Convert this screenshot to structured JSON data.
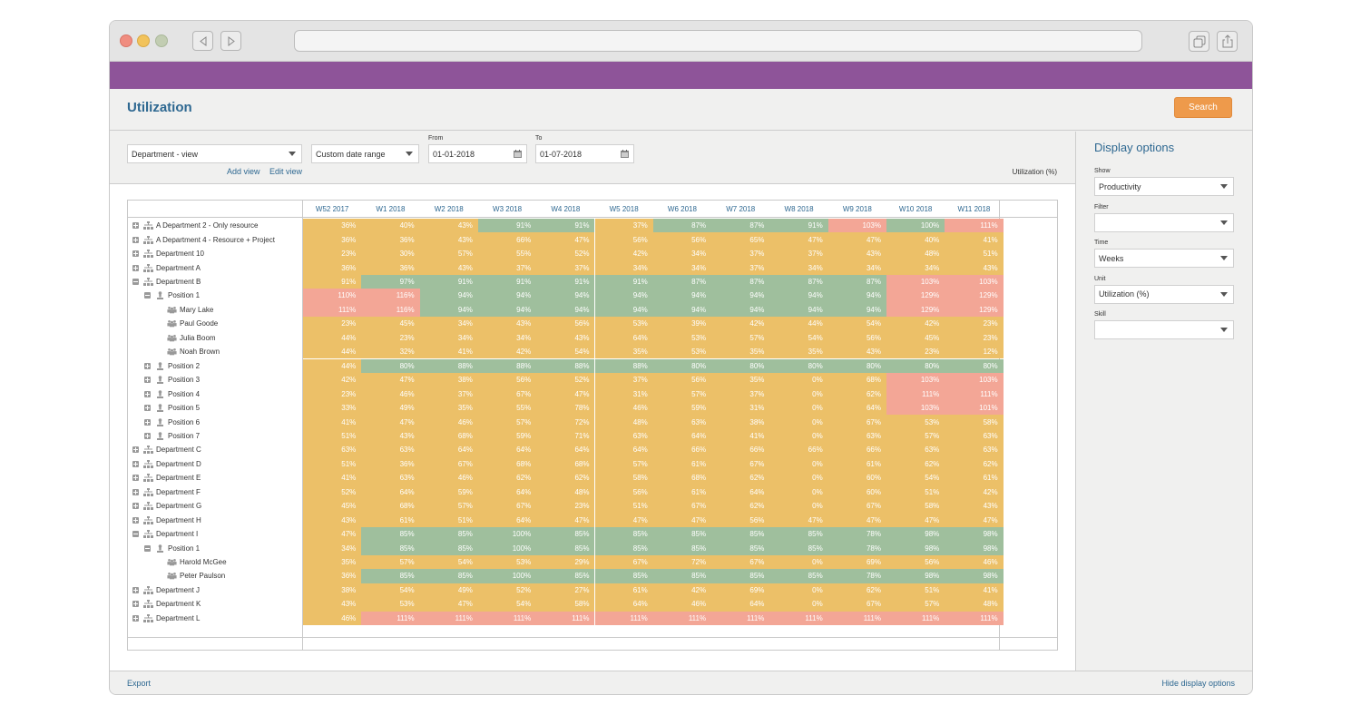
{
  "browser": {
    "traffic_lights": [
      "close",
      "minimize",
      "zoom"
    ],
    "back_icon": "back-arrow-icon",
    "forward_icon": "forward-arrow-icon",
    "url": ""
  },
  "page": {
    "title": "Utilization",
    "search_label": "Search"
  },
  "filters": {
    "view_select": "Department - view",
    "date_range_select": "Custom date range",
    "from_label": "From",
    "from_value": "01-01-2018",
    "to_label": "To",
    "to_value": "01-07-2018",
    "add_view": "Add view",
    "edit_view": "Edit view",
    "unit_label": "Utilization (%)"
  },
  "colors": {
    "purple_bar": "#8e5499",
    "accent_blue": "#2e6891",
    "search_orange": "#ee9a4b",
    "under": "#ecc068",
    "optimal": "#9fbf9d",
    "over": "#f3a696"
  },
  "grid": {
    "columns": [
      "W52 2017",
      "W1 2018",
      "W2 2018",
      "W3 2018",
      "W4 2018",
      "W5 2018",
      "W6 2018",
      "W7 2018",
      "W8 2018",
      "W9 2018",
      "W10 2018",
      "W11 2018"
    ],
    "rows": [
      {
        "name": "A Department 2 - Only resource",
        "level": 0,
        "type": "department",
        "expanded": false,
        "values": [
          "36%",
          "40%",
          "43%",
          "91%",
          "91%",
          "37%",
          "87%",
          "87%",
          "91%",
          "103%",
          "100%",
          "111%"
        ],
        "status": [
          "u",
          "u",
          "u",
          "g",
          "g",
          "u",
          "g",
          "g",
          "g",
          "r",
          "g",
          "r"
        ]
      },
      {
        "name": "A Department 4 - Resource + Project",
        "level": 0,
        "type": "department",
        "expanded": false,
        "values": [
          "36%",
          "36%",
          "43%",
          "66%",
          "47%",
          "56%",
          "56%",
          "65%",
          "47%",
          "47%",
          "40%",
          "41%"
        ],
        "status": [
          "u",
          "u",
          "u",
          "u",
          "u",
          "u",
          "u",
          "u",
          "u",
          "u",
          "u",
          "u"
        ]
      },
      {
        "name": "Department 10",
        "level": 0,
        "type": "department",
        "expanded": false,
        "values": [
          "23%",
          "30%",
          "57%",
          "55%",
          "52%",
          "42%",
          "34%",
          "37%",
          "37%",
          "43%",
          "48%",
          "51%"
        ],
        "status": [
          "u",
          "u",
          "u",
          "u",
          "u",
          "u",
          "u",
          "u",
          "u",
          "u",
          "u",
          "u"
        ]
      },
      {
        "name": "Department A",
        "level": 0,
        "type": "department",
        "expanded": false,
        "values": [
          "36%",
          "36%",
          "43%",
          "37%",
          "37%",
          "34%",
          "34%",
          "37%",
          "34%",
          "34%",
          "34%",
          "43%"
        ],
        "status": [
          "u",
          "u",
          "u",
          "u",
          "u",
          "u",
          "u",
          "u",
          "u",
          "u",
          "u",
          "u"
        ]
      },
      {
        "name": "Department B",
        "level": 0,
        "type": "department",
        "expanded": true,
        "values": [
          "91%",
          "97%",
          "91%",
          "91%",
          "91%",
          "91%",
          "87%",
          "87%",
          "87%",
          "87%",
          "103%",
          "103%"
        ],
        "status": [
          "u",
          "g",
          "g",
          "g",
          "g",
          "g",
          "g",
          "g",
          "g",
          "g",
          "r",
          "r"
        ]
      },
      {
        "name": "Position 1",
        "level": 1,
        "type": "position",
        "expanded": true,
        "values": [
          "110%",
          "116%",
          "94%",
          "94%",
          "94%",
          "94%",
          "94%",
          "94%",
          "94%",
          "94%",
          "129%",
          "129%"
        ],
        "status": [
          "r",
          "r",
          "g",
          "g",
          "g",
          "g",
          "g",
          "g",
          "g",
          "g",
          "r",
          "r"
        ]
      },
      {
        "name": "Mary Lake",
        "level": 2,
        "type": "person",
        "values": [
          "111%",
          "116%",
          "94%",
          "94%",
          "94%",
          "94%",
          "94%",
          "94%",
          "94%",
          "94%",
          "129%",
          "129%"
        ],
        "status": [
          "r",
          "r",
          "g",
          "g",
          "g",
          "g",
          "g",
          "g",
          "g",
          "g",
          "r",
          "r"
        ]
      },
      {
        "name": "Paul Goode",
        "level": 2,
        "type": "person",
        "values": [
          "23%",
          "45%",
          "34%",
          "43%",
          "56%",
          "53%",
          "39%",
          "42%",
          "44%",
          "54%",
          "42%",
          "23%"
        ],
        "status": [
          "u",
          "u",
          "u",
          "u",
          "u",
          "u",
          "u",
          "u",
          "u",
          "u",
          "u",
          "u"
        ]
      },
      {
        "name": "Julia Boom",
        "level": 2,
        "type": "person",
        "values": [
          "44%",
          "23%",
          "34%",
          "34%",
          "43%",
          "64%",
          "53%",
          "57%",
          "54%",
          "56%",
          "45%",
          "23%"
        ],
        "status": [
          "u",
          "u",
          "u",
          "u",
          "u",
          "u",
          "u",
          "u",
          "u",
          "u",
          "u",
          "u"
        ]
      },
      {
        "name": "Noah Brown",
        "level": 2,
        "type": "person",
        "values": [
          "44%",
          "32%",
          "41%",
          "42%",
          "54%",
          "35%",
          "53%",
          "35%",
          "35%",
          "43%",
          "23%",
          "12%"
        ],
        "status": [
          "u",
          "u",
          "u",
          "u",
          "u",
          "u",
          "u",
          "u",
          "u",
          "u",
          "u",
          "u"
        ]
      },
      {
        "name": "Position 2",
        "level": 1,
        "type": "position",
        "expanded": false,
        "values": [
          "44%",
          "80%",
          "88%",
          "88%",
          "88%",
          "88%",
          "80%",
          "80%",
          "80%",
          "80%",
          "80%",
          "80%"
        ],
        "status": [
          "u",
          "g",
          "g",
          "g",
          "g",
          "g",
          "g",
          "g",
          "g",
          "g",
          "g",
          "g"
        ]
      },
      {
        "name": "Position 3",
        "level": 1,
        "type": "position",
        "expanded": false,
        "values": [
          "42%",
          "47%",
          "38%",
          "56%",
          "52%",
          "37%",
          "56%",
          "35%",
          "0%",
          "68%",
          "103%",
          "103%"
        ],
        "status": [
          "u",
          "u",
          "u",
          "u",
          "u",
          "u",
          "u",
          "u",
          "u",
          "u",
          "r",
          "r"
        ]
      },
      {
        "name": "Position 4",
        "level": 1,
        "type": "position",
        "expanded": false,
        "values": [
          "23%",
          "46%",
          "37%",
          "67%",
          "47%",
          "31%",
          "57%",
          "37%",
          "0%",
          "62%",
          "111%",
          "111%"
        ],
        "status": [
          "u",
          "u",
          "u",
          "u",
          "u",
          "u",
          "u",
          "u",
          "u",
          "u",
          "r",
          "r"
        ]
      },
      {
        "name": "Position 5",
        "level": 1,
        "type": "position",
        "expanded": false,
        "values": [
          "33%",
          "49%",
          "35%",
          "55%",
          "78%",
          "46%",
          "59%",
          "31%",
          "0%",
          "64%",
          "103%",
          "101%"
        ],
        "status": [
          "u",
          "u",
          "u",
          "u",
          "u",
          "u",
          "u",
          "u",
          "u",
          "u",
          "r",
          "r"
        ]
      },
      {
        "name": "Position 6",
        "level": 1,
        "type": "position",
        "expanded": false,
        "values": [
          "41%",
          "47%",
          "46%",
          "57%",
          "72%",
          "48%",
          "63%",
          "38%",
          "0%",
          "67%",
          "53%",
          "58%"
        ],
        "status": [
          "u",
          "u",
          "u",
          "u",
          "u",
          "u",
          "u",
          "u",
          "u",
          "u",
          "u",
          "u"
        ]
      },
      {
        "name": "Position 7",
        "level": 1,
        "type": "position",
        "expanded": false,
        "values": [
          "51%",
          "43%",
          "68%",
          "59%",
          "71%",
          "63%",
          "64%",
          "41%",
          "0%",
          "63%",
          "57%",
          "63%"
        ],
        "status": [
          "u",
          "u",
          "u",
          "u",
          "u",
          "u",
          "u",
          "u",
          "u",
          "u",
          "u",
          "u"
        ]
      },
      {
        "name": "Department C",
        "level": 0,
        "type": "department",
        "expanded": false,
        "values": [
          "63%",
          "63%",
          "64%",
          "64%",
          "64%",
          "64%",
          "66%",
          "66%",
          "66%",
          "66%",
          "63%",
          "63%"
        ],
        "status": [
          "u",
          "u",
          "u",
          "u",
          "u",
          "u",
          "u",
          "u",
          "u",
          "u",
          "u",
          "u"
        ]
      },
      {
        "name": "Department D",
        "level": 0,
        "type": "department",
        "expanded": false,
        "values": [
          "51%",
          "36%",
          "67%",
          "68%",
          "68%",
          "57%",
          "61%",
          "67%",
          "0%",
          "61%",
          "62%",
          "62%"
        ],
        "status": [
          "u",
          "u",
          "u",
          "u",
          "u",
          "u",
          "u",
          "u",
          "u",
          "u",
          "u",
          "u"
        ]
      },
      {
        "name": "Department E",
        "level": 0,
        "type": "department",
        "expanded": false,
        "values": [
          "41%",
          "63%",
          "46%",
          "62%",
          "62%",
          "58%",
          "68%",
          "62%",
          "0%",
          "60%",
          "54%",
          "61%"
        ],
        "status": [
          "u",
          "u",
          "u",
          "u",
          "u",
          "u",
          "u",
          "u",
          "u",
          "u",
          "u",
          "u"
        ]
      },
      {
        "name": "Department F",
        "level": 0,
        "type": "department",
        "expanded": false,
        "values": [
          "52%",
          "64%",
          "59%",
          "64%",
          "48%",
          "56%",
          "61%",
          "64%",
          "0%",
          "60%",
          "51%",
          "42%"
        ],
        "status": [
          "u",
          "u",
          "u",
          "u",
          "u",
          "u",
          "u",
          "u",
          "u",
          "u",
          "u",
          "u"
        ]
      },
      {
        "name": "Department G",
        "level": 0,
        "type": "department",
        "expanded": false,
        "values": [
          "45%",
          "68%",
          "57%",
          "67%",
          "23%",
          "51%",
          "67%",
          "62%",
          "0%",
          "67%",
          "58%",
          "43%"
        ],
        "status": [
          "u",
          "u",
          "u",
          "u",
          "u",
          "u",
          "u",
          "u",
          "u",
          "u",
          "u",
          "u"
        ]
      },
      {
        "name": "Department H",
        "level": 0,
        "type": "department",
        "expanded": false,
        "values": [
          "43%",
          "61%",
          "51%",
          "64%",
          "47%",
          "47%",
          "47%",
          "56%",
          "47%",
          "47%",
          "47%",
          "47%"
        ],
        "status": [
          "u",
          "u",
          "u",
          "u",
          "u",
          "u",
          "u",
          "u",
          "u",
          "u",
          "u",
          "u"
        ]
      },
      {
        "name": "Department I",
        "level": 0,
        "type": "department",
        "expanded": true,
        "values": [
          "47%",
          "85%",
          "85%",
          "100%",
          "85%",
          "85%",
          "85%",
          "85%",
          "85%",
          "78%",
          "98%",
          "98%"
        ],
        "status": [
          "u",
          "g",
          "g",
          "g",
          "g",
          "g",
          "g",
          "g",
          "g",
          "g",
          "g",
          "g"
        ]
      },
      {
        "name": "Position 1",
        "level": 1,
        "type": "position",
        "expanded": true,
        "values": [
          "34%",
          "85%",
          "85%",
          "100%",
          "85%",
          "85%",
          "85%",
          "85%",
          "85%",
          "78%",
          "98%",
          "98%"
        ],
        "status": [
          "u",
          "g",
          "g",
          "g",
          "g",
          "g",
          "g",
          "g",
          "g",
          "g",
          "g",
          "g"
        ]
      },
      {
        "name": "Harold McGee",
        "level": 2,
        "type": "person",
        "values": [
          "35%",
          "57%",
          "54%",
          "53%",
          "29%",
          "67%",
          "72%",
          "67%",
          "0%",
          "69%",
          "56%",
          "46%"
        ],
        "status": [
          "u",
          "u",
          "u",
          "u",
          "u",
          "u",
          "u",
          "u",
          "u",
          "u",
          "u",
          "u"
        ]
      },
      {
        "name": "Peter Paulson",
        "level": 2,
        "type": "person",
        "values": [
          "36%",
          "85%",
          "85%",
          "100%",
          "85%",
          "85%",
          "85%",
          "85%",
          "85%",
          "78%",
          "98%",
          "98%"
        ],
        "status": [
          "u",
          "g",
          "g",
          "g",
          "g",
          "g",
          "g",
          "g",
          "g",
          "g",
          "g",
          "g"
        ]
      },
      {
        "name": "Department J",
        "level": 0,
        "type": "department",
        "expanded": false,
        "values": [
          "38%",
          "54%",
          "49%",
          "52%",
          "27%",
          "61%",
          "42%",
          "69%",
          "0%",
          "62%",
          "51%",
          "41%"
        ],
        "status": [
          "u",
          "u",
          "u",
          "u",
          "u",
          "u",
          "u",
          "u",
          "u",
          "u",
          "u",
          "u"
        ]
      },
      {
        "name": "Department K",
        "level": 0,
        "type": "department",
        "expanded": false,
        "values": [
          "43%",
          "53%",
          "47%",
          "54%",
          "58%",
          "64%",
          "46%",
          "64%",
          "0%",
          "67%",
          "57%",
          "48%"
        ],
        "status": [
          "u",
          "u",
          "u",
          "u",
          "u",
          "u",
          "u",
          "u",
          "u",
          "u",
          "u",
          "u"
        ]
      },
      {
        "name": "Department L",
        "level": 0,
        "type": "department",
        "expanded": false,
        "values": [
          "46%",
          "111%",
          "111%",
          "111%",
          "111%",
          "111%",
          "111%",
          "111%",
          "111%",
          "111%",
          "111%",
          "111%"
        ],
        "status": [
          "u",
          "r",
          "r",
          "r",
          "r",
          "r",
          "r",
          "r",
          "r",
          "r",
          "r",
          "r"
        ]
      }
    ]
  },
  "display_options": {
    "title": "Display options",
    "fields": [
      {
        "label": "Show",
        "value": "Productivity"
      },
      {
        "label": "Filter",
        "value": ""
      },
      {
        "label": "Time",
        "value": "Weeks"
      },
      {
        "label": "Unit",
        "value": "Utilization (%)"
      },
      {
        "label": "Skill",
        "value": ""
      }
    ]
  },
  "footer": {
    "export": "Export",
    "hide_options": "Hide display options"
  }
}
